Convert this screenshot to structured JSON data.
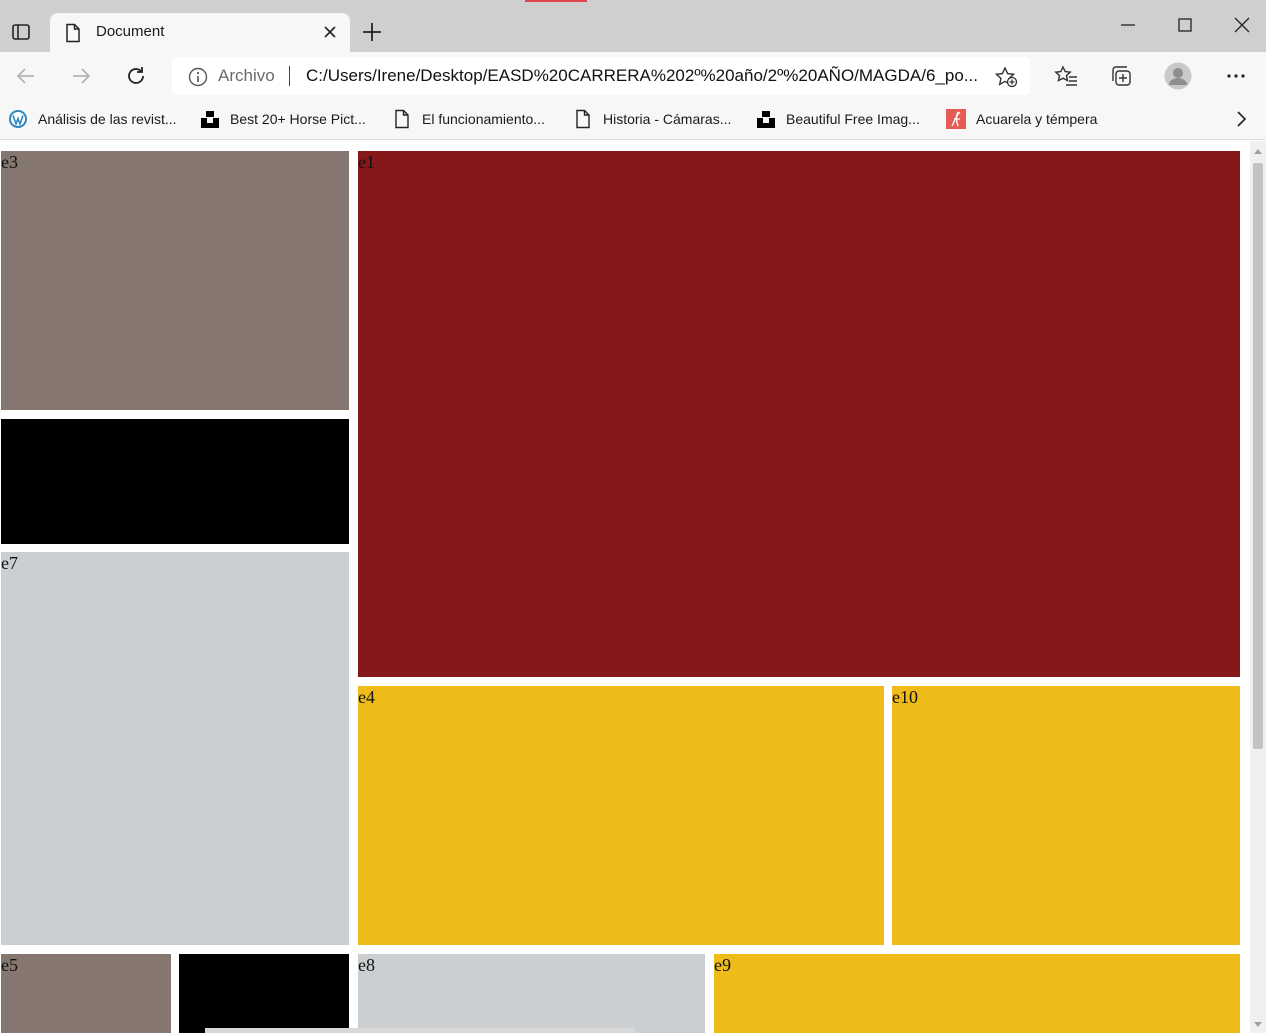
{
  "window": {
    "tab_title": "Document",
    "accent_color": "#e0454b"
  },
  "toolbar": {
    "scheme_label": "Archivo",
    "url": "C:/Users/Irene/Desktop/EASD%20CARRERA%202º%20año/2º%20AÑO/MAGDA/6_po..."
  },
  "bookmarks": [
    {
      "label": "Análisis de las revist...",
      "icon": "wordpress-icon"
    },
    {
      "label": "Best 20+ Horse Pict...",
      "icon": "unsplash-icon"
    },
    {
      "label": "El funcionamiento...",
      "icon": "page-icon"
    },
    {
      "label": "Historia - Cámaras...",
      "icon": "page-icon"
    },
    {
      "label": "Beautiful Free Imag...",
      "icon": "unsplash-icon"
    },
    {
      "label": "Acuarela y témpera",
      "icon": "font-icon"
    }
  ],
  "boxes": [
    {
      "id": "e3",
      "label": "e3",
      "color": "#857770"
    },
    {
      "id": "black-top",
      "label": "",
      "color": "#000000"
    },
    {
      "id": "e7",
      "label": "e7",
      "color": "#cbcfd1"
    },
    {
      "id": "e1",
      "label": "e1",
      "color": "#86181a"
    },
    {
      "id": "e4",
      "label": "e4",
      "color": "#efbb19"
    },
    {
      "id": "e10",
      "label": "e10",
      "color": "#efbb19"
    },
    {
      "id": "e5",
      "label": "e5",
      "color": "#857770"
    },
    {
      "id": "black-bottom",
      "label": "",
      "color": "#000000"
    },
    {
      "id": "e8",
      "label": "e8",
      "color": "#cbcfd1"
    },
    {
      "id": "e9",
      "label": "e9",
      "color": "#efbb19"
    }
  ]
}
